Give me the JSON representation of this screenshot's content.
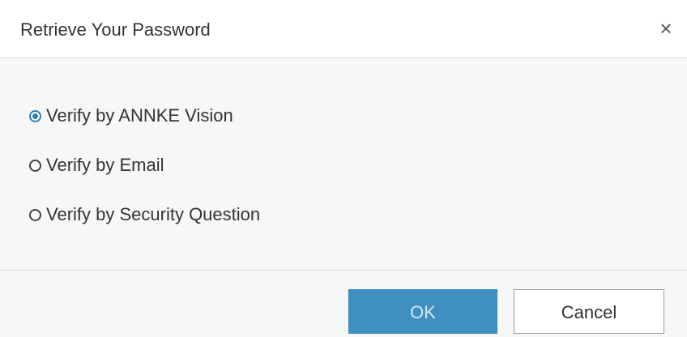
{
  "dialog": {
    "title": "Retrieve Your Password",
    "close_symbol": "×"
  },
  "options": [
    {
      "label": "Verify by ANNKE Vision",
      "selected": true
    },
    {
      "label": "Verify by Email",
      "selected": false
    },
    {
      "label": "Verify by Security Question",
      "selected": false
    }
  ],
  "footer": {
    "ok_label": "OK",
    "cancel_label": "Cancel"
  },
  "colors": {
    "accent": "#3f8fc0",
    "radio_selected": "#2e7fb5",
    "text": "#333333",
    "divider": "#d9d9d9"
  }
}
